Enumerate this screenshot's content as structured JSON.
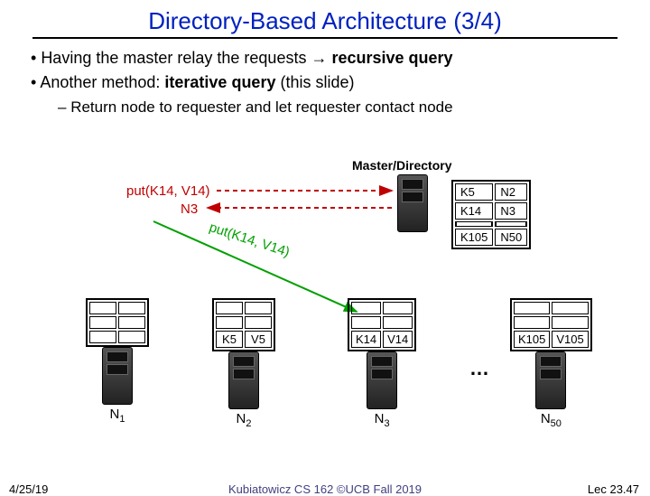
{
  "title": "Directory-Based Architecture (3/4)",
  "bullets": {
    "b1a_pre": "Having the master relay the requests ",
    "b1a_arrow": "→",
    "b1a_bold": " recursive query",
    "b1b_pre": "Another method: ",
    "b1b_bold": "iterative query",
    "b1b_post": " (this slide)",
    "b2a": "Return node to requester and let requester contact node"
  },
  "diagram": {
    "md_label": "Master/Directory",
    "put_call": "put(K14, V14)",
    "put_reply": "N3",
    "put_fwd": "put(K14, V14)",
    "dir": {
      "r1k": "K5",
      "r1v": "N2",
      "r2k": "K14",
      "r2v": "N3",
      "r3k": "K105",
      "r3v": "N50"
    },
    "nodes": {
      "n1": {
        "label_base": "N",
        "label_sub": "1",
        "k": "",
        "v": ""
      },
      "n2": {
        "label_base": "N",
        "label_sub": "2",
        "k": "K5",
        "v": "V5"
      },
      "n3": {
        "label_base": "N",
        "label_sub": "3",
        "k": "K14",
        "v": "V14"
      },
      "n50": {
        "label_base": "N",
        "label_sub": "50",
        "k": "K105",
        "v": "V105"
      }
    },
    "ellipsis": "…"
  },
  "footer": {
    "date": "4/25/19",
    "mid": "Kubiatowicz CS 162 ©UCB Fall 2019",
    "lec": "Lec 23.47"
  }
}
